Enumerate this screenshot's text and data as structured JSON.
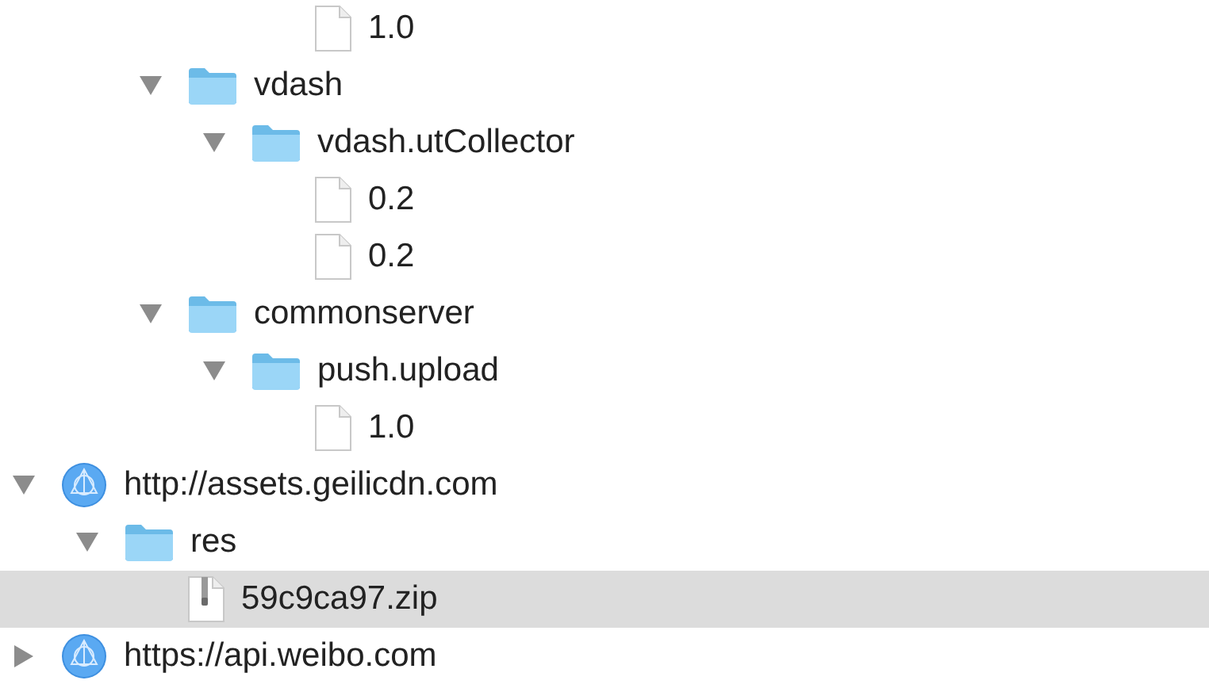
{
  "tree": [
    {
      "children": [
        {
          "children": [
            {
              "children": [
                {
                  "children": [
                    {
                      "kind": "file",
                      "label": "1.0",
                      "selected": false
                    }
                  ]
                }
              ]
            },
            {
              "kind": "folder",
              "label": "vdash",
              "expanded": true,
              "selected": false,
              "children": [
                {
                  "kind": "folder",
                  "label": "vdash.utCollector",
                  "expanded": true,
                  "selected": false,
                  "children": [
                    {
                      "kind": "file",
                      "label": "0.2",
                      "selected": false
                    },
                    {
                      "kind": "file",
                      "label": "0.2",
                      "selected": false
                    }
                  ]
                }
              ]
            },
            {
              "kind": "folder",
              "label": "commonserver",
              "expanded": true,
              "selected": false,
              "children": [
                {
                  "kind": "folder",
                  "label": "push.upload",
                  "expanded": true,
                  "selected": false,
                  "children": [
                    {
                      "kind": "file",
                      "label": "1.0",
                      "selected": false
                    }
                  ]
                }
              ]
            }
          ]
        }
      ]
    },
    {
      "kind": "host",
      "label": "http://assets.geilicdn.com",
      "expanded": true,
      "selected": false,
      "children": [
        {
          "kind": "folder",
          "label": "res",
          "expanded": true,
          "selected": false,
          "children": [
            {
              "kind": "archive",
              "label": "59c9ca97.zip",
              "selected": true
            }
          ]
        }
      ]
    },
    {
      "kind": "host",
      "label": "https://api.weibo.com",
      "expanded": false,
      "selected": false
    }
  ]
}
